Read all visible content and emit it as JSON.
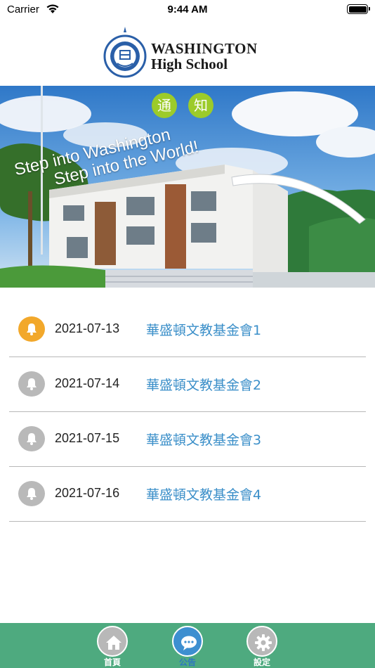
{
  "status_bar": {
    "carrier": "Carrier",
    "time": "9:44 AM",
    "icons": [
      "wifi-icon",
      "battery-icon"
    ]
  },
  "header": {
    "logo_icon": "school-seal-icon",
    "school_name_line1": "WASHINGTON",
    "school_name_line2": "High School"
  },
  "banner": {
    "notice_chars": [
      "通",
      "知"
    ],
    "slogan_line1": "Step into Washington",
    "slogan_line2": "Step into the World!"
  },
  "notices": [
    {
      "date": "2021-07-13",
      "title": "華盛頓文教基金會1",
      "unread": true
    },
    {
      "date": "2021-07-14",
      "title": "華盛頓文教基金會2",
      "unread": false
    },
    {
      "date": "2021-07-15",
      "title": "華盛頓文教基金會3",
      "unread": false
    },
    {
      "date": "2021-07-16",
      "title": "華盛頓文教基金會4",
      "unread": false
    }
  ],
  "tabs": [
    {
      "label": "首頁",
      "icon": "home-icon",
      "active": false
    },
    {
      "label": "公告",
      "icon": "chat-bubble-icon",
      "active": true
    },
    {
      "label": "設定",
      "icon": "gear-icon",
      "active": false
    }
  ],
  "colors": {
    "tab_bar": "#4eaa7f",
    "active_tab": "#3d8fd0",
    "unread_bell": "#f2a82b",
    "read_bell": "#b9b9b9",
    "notice_title": "#3b8fc9",
    "notice_badge": "#9ccb2a"
  }
}
